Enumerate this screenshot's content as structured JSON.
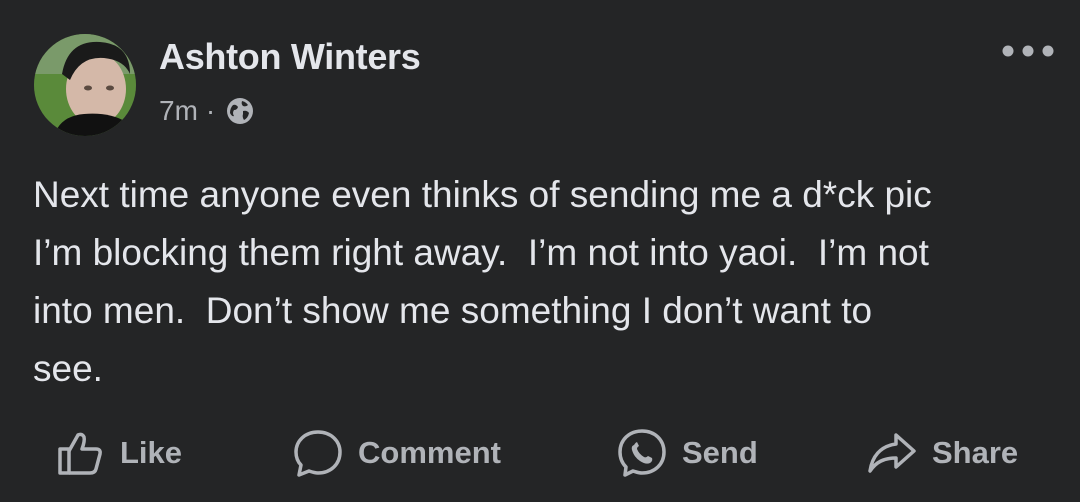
{
  "post": {
    "author": {
      "name": "Ashton Winters"
    },
    "timestamp": "7m",
    "separator": "·",
    "audience_icon": "globe-icon",
    "text": "Next time anyone even thinks of sending me a d*ck pic\nI’m blocking them right away.  I’m not into yaoi.  I’m not\ninto men.  Don’t show me something I don’t want to\nsee.",
    "more_icon": "more-options-icon"
  },
  "actions": [
    {
      "label": "Like",
      "icon": "like-icon"
    },
    {
      "label": "Comment",
      "icon": "comment-icon"
    },
    {
      "label": "Send",
      "icon": "messenger-icon"
    },
    {
      "label": "Share",
      "icon": "share-icon"
    }
  ],
  "colors": {
    "background": "#242526",
    "primary_text": "#e4e6eb",
    "secondary_text": "#b0b3b8"
  }
}
